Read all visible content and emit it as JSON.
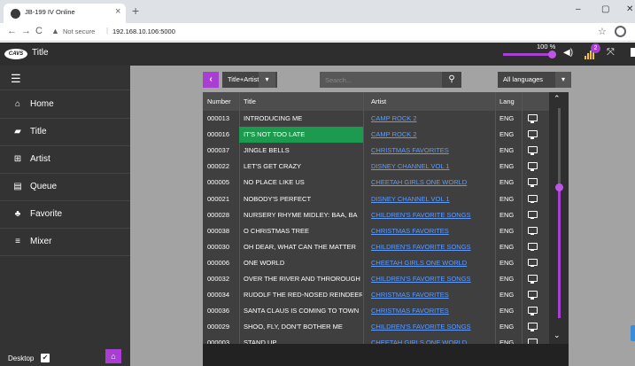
{
  "browser": {
    "tab_title": "JB-199 IV Online",
    "tab_close": "×",
    "new_tab": "+",
    "window_controls": [
      "–",
      "▢",
      "✕"
    ],
    "nav": [
      "←",
      "→",
      "C"
    ],
    "warning_icon": "▲",
    "not_secure": "Not secure",
    "separator": "|",
    "url": "192.168.10.106:5000",
    "star": "☆"
  },
  "app": {
    "logo": "CAVS",
    "title": "Title",
    "volume_percent": "100 %",
    "volume_level": 100,
    "signal_badge": "2",
    "colors": {
      "accent": "#a83ed2",
      "highlight": "#1c9a4e",
      "link": "#5c9bff"
    }
  },
  "sidebar": {
    "menu_icon": "☰",
    "items": [
      {
        "label": "Home",
        "icon": "home-icon",
        "glyph": "⌂"
      },
      {
        "label": "Title",
        "icon": "book-icon",
        "glyph": "▰"
      },
      {
        "label": "Artist",
        "icon": "artist-table-icon",
        "glyph": "⊞"
      },
      {
        "label": "Queue",
        "icon": "queue-list-icon",
        "glyph": "▤"
      },
      {
        "label": "Favorite",
        "icon": "users-icon",
        "glyph": "♣"
      },
      {
        "label": "Mixer",
        "icon": "sliders-icon",
        "glyph": "≡"
      }
    ],
    "desktop_label": "Desktop",
    "desktop_checked": true,
    "check_glyph": "✔",
    "home_glyph": "⌂"
  },
  "controls": {
    "back_glyph": "‹",
    "mode": "Title+Artist",
    "dropdown_glyph": "▾",
    "search_placeholder": "Search...",
    "search_glyph": "⚲",
    "language": "All languages"
  },
  "table": {
    "headers": {
      "number": "Number",
      "title": "Title",
      "artist": "Artist",
      "lang": "Lang"
    },
    "highlighted_row": 1,
    "rows": [
      {
        "number": "000013",
        "title": "INTRODUCING ME",
        "artist": "CAMP ROCK 2",
        "lang": "ENG"
      },
      {
        "number": "000016",
        "title": "IT'S NOT TOO LATE",
        "artist": "CAMP ROCK 2",
        "lang": "ENG"
      },
      {
        "number": "000037",
        "title": "JINGLE BELLS",
        "artist": "CHRISTMAS FAVORITES",
        "lang": "ENG"
      },
      {
        "number": "000022",
        "title": "LET'S GET CRAZY",
        "artist": "DISNEY CHANNEL VOL 1",
        "lang": "ENG"
      },
      {
        "number": "000005",
        "title": "NO PLACE LIKE US",
        "artist": "CHEETAH GIRLS ONE WORLD",
        "lang": "ENG"
      },
      {
        "number": "000021",
        "title": "NOBODY'S PERFECT",
        "artist": "DISNEY CHANNEL VOL 1",
        "lang": "ENG"
      },
      {
        "number": "000028",
        "title": "NURSERY RHYME MIDLEY: BAA, BA",
        "artist": "CHILDREN'S FAVORITE SONGS",
        "lang": "ENG"
      },
      {
        "number": "000038",
        "title": "O CHRISTMAS TREE",
        "artist": "CHRISTMAS FAVORITES",
        "lang": "ENG"
      },
      {
        "number": "000030",
        "title": "OH DEAR, WHAT CAN THE MATTER",
        "artist": "CHILDREN'S FAVORITE SONGS",
        "lang": "ENG"
      },
      {
        "number": "000006",
        "title": "ONE WORLD",
        "artist": "CHEETAH GIRLS ONE WORLD",
        "lang": "ENG"
      },
      {
        "number": "000032",
        "title": "OVER THE RIVER AND THROROUGH",
        "artist": "CHILDREN'S FAVORITE SONGS",
        "lang": "ENG"
      },
      {
        "number": "000034",
        "title": "RUDOLF THE RED-NOSED REINDEER",
        "artist": "CHRISTMAS FAVORITES",
        "lang": "ENG"
      },
      {
        "number": "000036",
        "title": "SANTA CLAUS IS COMING TO TOWN",
        "artist": "CHRISTMAS FAVORITES",
        "lang": "ENG"
      },
      {
        "number": "000029",
        "title": "SHOO, FLY, DON'T BOTHER ME",
        "artist": "CHILDREN'S FAVORITE SONGS",
        "lang": "ENG"
      },
      {
        "number": "000003",
        "title": "STAND UP",
        "artist": "CHEETAH GIRLS ONE WORLD",
        "lang": "ENG"
      }
    ]
  },
  "scroll": {
    "up_glyph": "⌃",
    "down_glyph": "⌄",
    "position": 0.38
  }
}
